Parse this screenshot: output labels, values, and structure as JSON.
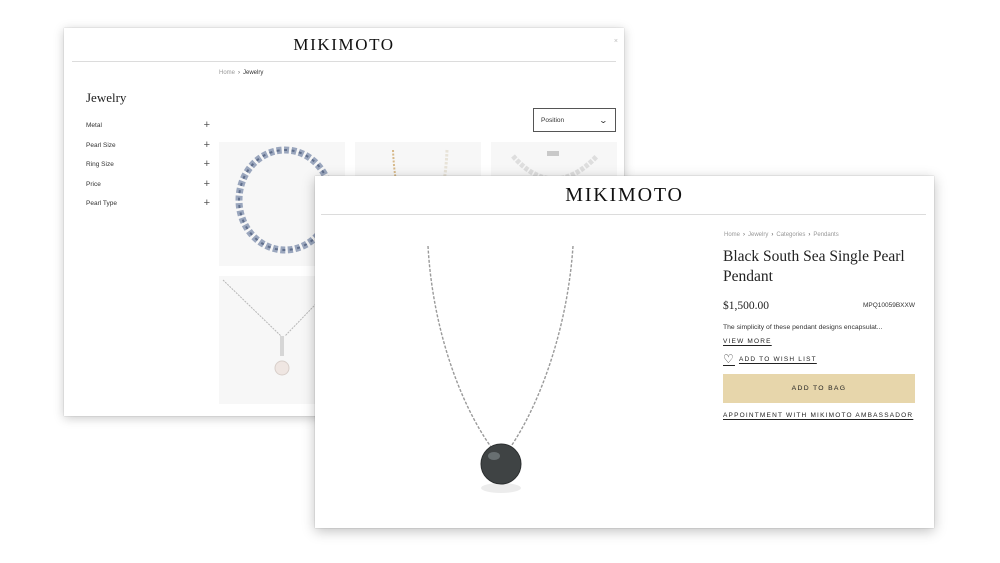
{
  "brand": "MIKIMOTO",
  "listing": {
    "close_label": "×",
    "breadcrumb": {
      "home": "Home",
      "sep": "›",
      "current": "Jewelry"
    },
    "title": "Jewelry",
    "filters": [
      {
        "label": "Metal",
        "icon": "plus-icon",
        "symbol": "+"
      },
      {
        "label": "Pearl Size",
        "icon": "plus-icon",
        "symbol": "+"
      },
      {
        "label": "Ring Size",
        "icon": "plus-icon",
        "symbol": "+"
      },
      {
        "label": "Price",
        "icon": "plus-icon",
        "symbol": "+"
      },
      {
        "label": "Pearl Type",
        "icon": "plus-icon",
        "symbol": "+"
      }
    ],
    "sort": {
      "selected": "Position",
      "icon": "chevron-down-icon",
      "chevron": "⌄"
    }
  },
  "product": {
    "breadcrumb": [
      "Home",
      "Jewelry",
      "Categories",
      "Pendants"
    ],
    "sep": "›",
    "title": "Black South Sea Single Pearl Pendant",
    "price": "$1,500.00",
    "sku": "MPQ10059BXXW",
    "description": "The simplicity of these pendant designs encapsulat...",
    "view_more": "VIEW MORE",
    "wishlist": {
      "label": "ADD TO WISH LIST",
      "icon": "heart-icon",
      "symbol": "♡"
    },
    "add_to_bag": "ADD TO BAG",
    "appointment": "APPOINTMENT WITH MIKIMOTO AMBASSADOR"
  },
  "colors": {
    "accent_button": "#e7d6ab",
    "text": "#222222",
    "divider": "#dcdcdc",
    "tile_bg": "#f7f7f7"
  }
}
